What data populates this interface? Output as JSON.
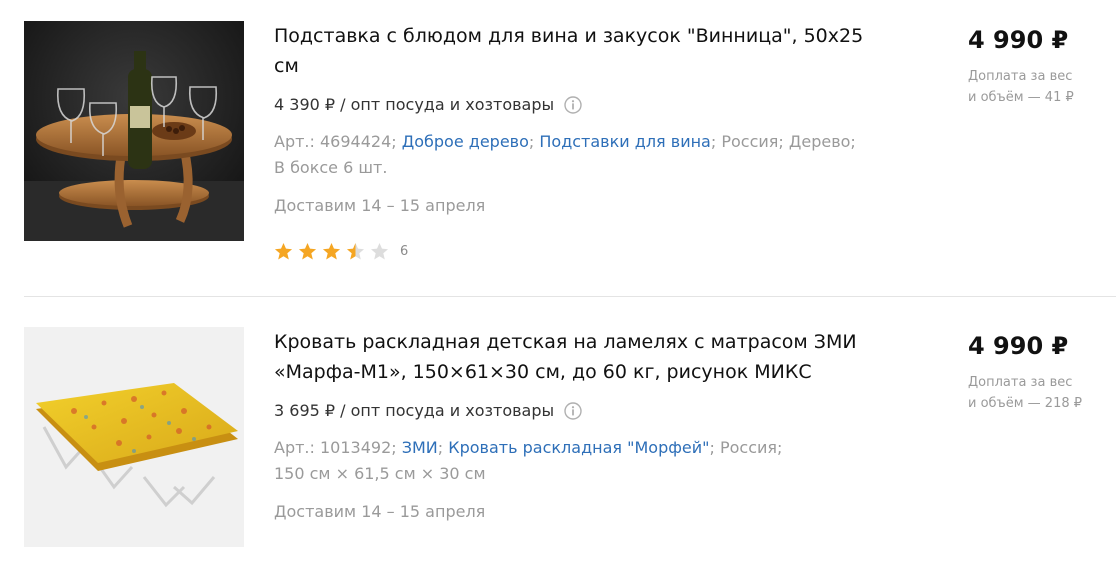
{
  "products": [
    {
      "title": "Подставка с блюдом для вина и закусок \"Винница\", 50х25 см",
      "wholesale_price": "4 390 ₽ / опт посуда и хозтовары",
      "article_label": "Арт.: 4694424;",
      "brand": "Доброе дерево",
      "category": "Подставки для вина",
      "extra_text": "; Россия; Дерево;",
      "extra_text_2": "В боксе 6 шт.",
      "delivery": "Доставим 14 – 15 апреля",
      "rating": 3.5,
      "rating_max": 5,
      "rating_count": "6",
      "price": "4 990 ₽",
      "surcharge_line1": "Доплата за вес",
      "surcharge_line2": "и объём — 41 ₽",
      "image_icon": "wine-stand-photo"
    },
    {
      "title": "Кровать раскладная детская на ламелях с матрасом ЗМИ «Марфа-М1», 150×61×30 см, до 60 кг, рисунок МИКС",
      "wholesale_price": "3 695 ₽ / опт посуда и хозтовары",
      "article_label": "Арт.: 1013492;",
      "brand": "ЗМИ",
      "category": "Кровать раскладная \"Морфей\"",
      "extra_text": "; Россия;",
      "extra_text_2": "150 см × 61,5 см × 30 см",
      "delivery": "Доставим 14 – 15 апреля",
      "price": "4 990 ₽",
      "surcharge_line1": "Доплата за вес",
      "surcharge_line2": "и объём — 218 ₽",
      "image_icon": "folding-bed-photo"
    }
  ],
  "colors": {
    "link": "#2e6fb8",
    "star_filled": "#f5a623",
    "star_empty": "#dddddd",
    "muted_text": "#9a9a9a"
  }
}
